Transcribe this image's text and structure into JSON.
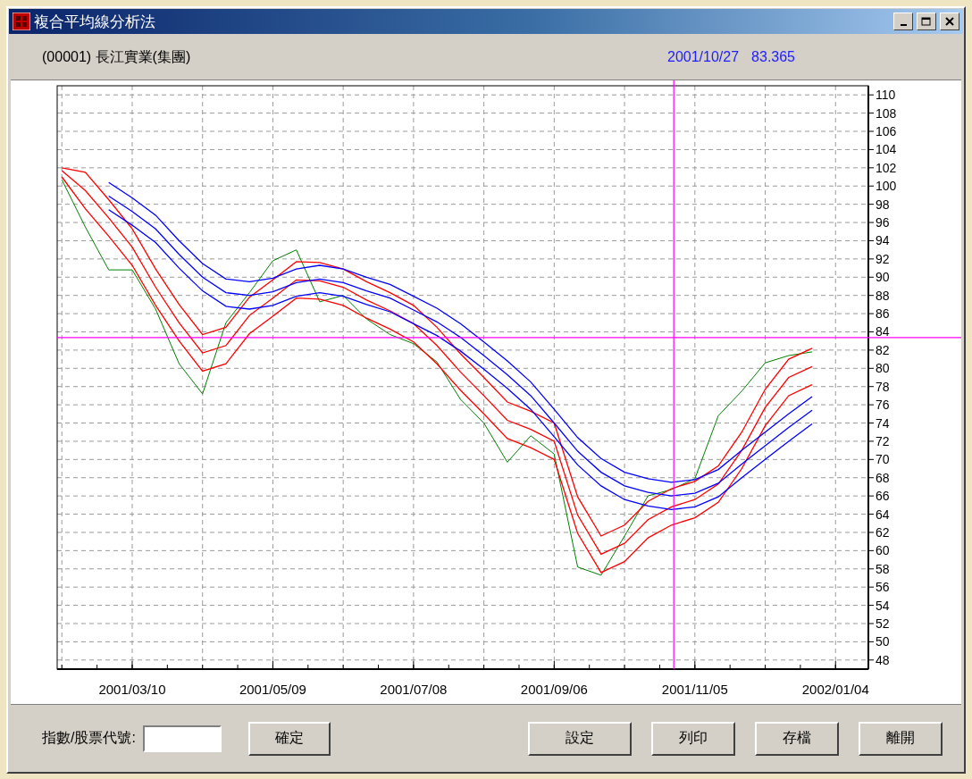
{
  "window": {
    "title": "複合平均線分析法"
  },
  "info_bar": {
    "stock": "(00001) 長江實業(集團)",
    "date": "2001/10/27",
    "value": "83.365"
  },
  "chart_data": {
    "type": "line",
    "categories": [
      null,
      null,
      null,
      "2001/03/10",
      null,
      null,
      null,
      null,
      null,
      "2001/05/09",
      null,
      null,
      null,
      null,
      null,
      "2001/07/08",
      null,
      null,
      null,
      null,
      null,
      "2001/09/06",
      null,
      null,
      null,
      null,
      null,
      "2001/11/05",
      null,
      null,
      null,
      null,
      null,
      "2002/01/04"
    ],
    "series": [
      {
        "color": "#008000",
        "values": [
          100.7,
          95.5,
          90.8,
          90.8,
          86.5,
          80.5,
          77.2,
          85,
          88.3,
          91.8,
          93,
          87.3,
          88,
          85.4,
          83.7,
          82.7,
          80.7,
          76.6,
          74,
          69.7,
          72.6,
          70.6,
          58.2,
          57.3,
          61.6,
          66,
          66.7,
          67.9,
          74.8,
          77.5,
          80.6,
          81.4,
          81.8,
          null
        ]
      },
      {
        "color": "#ff0000",
        "values": [
          102,
          101.5,
          98.5,
          95.3,
          90.9,
          87,
          83.7,
          84.5,
          87.8,
          89.7,
          91.7,
          91.6,
          90.9,
          89.5,
          88.3,
          86.9,
          84.5,
          81.6,
          79,
          76.3,
          75.3,
          74,
          65.9,
          61.6,
          62.8,
          65.4,
          66.8,
          67.6,
          69.3,
          73,
          77.7,
          81,
          82.2,
          null
        ]
      },
      {
        "color": "#ff0000",
        "values": [
          101.7,
          99.5,
          96.5,
          93.3,
          88.9,
          85,
          81.7,
          82.5,
          85.8,
          87.7,
          89.7,
          89.6,
          88.9,
          87.5,
          86.3,
          84.9,
          82.5,
          79.6,
          77,
          74.3,
          73.3,
          72,
          63.9,
          59.6,
          60.8,
          63.4,
          64.8,
          65.6,
          67.3,
          71,
          75.7,
          79,
          80.2,
          null
        ]
      },
      {
        "color": "#ff0000",
        "values": [
          101,
          97.5,
          94.5,
          91.3,
          86.9,
          83,
          79.7,
          80.5,
          83.8,
          85.7,
          87.7,
          87.6,
          86.9,
          85.5,
          84.3,
          82.9,
          80.5,
          77.6,
          75,
          72.3,
          71.3,
          70,
          61.9,
          57.6,
          58.8,
          61.4,
          62.8,
          63.6,
          65.3,
          69,
          73.7,
          77,
          78.2,
          null
        ]
      },
      {
        "color": "#0000ff",
        "values": [
          null,
          null,
          100.4,
          98.7,
          96.8,
          94,
          91.5,
          89.8,
          89.5,
          89.9,
          90.9,
          91.3,
          90.9,
          90,
          89.2,
          87.9,
          86.6,
          84.9,
          82.9,
          80.8,
          78.5,
          75.5,
          72.4,
          70.1,
          68.6,
          67.9,
          67.5,
          67.8,
          68.9,
          71,
          73,
          75,
          76.9,
          null
        ]
      },
      {
        "color": "#0000ff",
        "values": [
          null,
          null,
          98.9,
          97.2,
          95.3,
          92.5,
          90,
          88.3,
          88,
          88.4,
          89.4,
          89.8,
          89.4,
          88.5,
          87.7,
          86.4,
          85.1,
          83.4,
          81.4,
          79.3,
          77,
          74,
          70.9,
          68.6,
          67.1,
          66.4,
          66,
          66.3,
          67.4,
          69.5,
          71.5,
          73.5,
          75.4,
          null
        ]
      },
      {
        "color": "#0000ff",
        "values": [
          null,
          null,
          97.4,
          95.7,
          93.8,
          91,
          88.5,
          86.8,
          86.5,
          86.9,
          87.9,
          88.3,
          87.9,
          87,
          86.2,
          84.9,
          83.6,
          81.9,
          79.9,
          77.8,
          75.5,
          72.5,
          69.4,
          67.1,
          65.6,
          64.9,
          64.5,
          64.8,
          65.9,
          68,
          70,
          72,
          73.9,
          null
        ]
      }
    ],
    "ylim": [
      47,
      111
    ],
    "yticks": [
      48,
      50,
      52,
      54,
      56,
      58,
      60,
      62,
      64,
      66,
      68,
      70,
      72,
      74,
      76,
      78,
      80,
      82,
      84,
      86,
      88,
      90,
      92,
      94,
      96,
      98,
      100,
      102,
      104,
      106,
      108,
      110
    ],
    "grid": true,
    "ref_lines": [
      {
        "axis": "y",
        "value": 83.365,
        "color": "#ff00ff"
      }
    ]
  },
  "bottom_bar": {
    "code_label": "指數/股票代號:",
    "confirm_button": "確定",
    "buttons": [
      "設定",
      "列印",
      "存檔",
      "離開"
    ]
  }
}
